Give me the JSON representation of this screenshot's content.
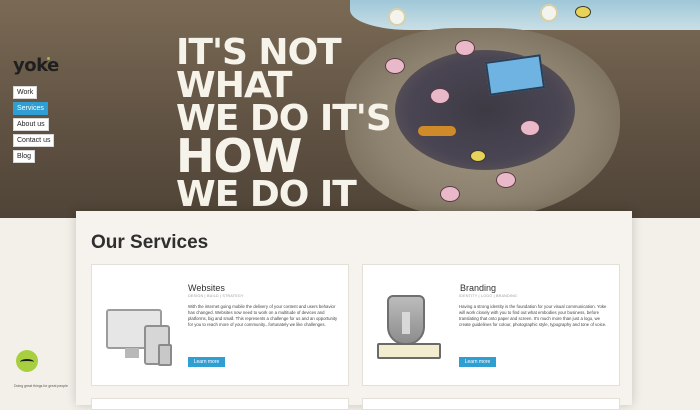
{
  "brand": {
    "logo": "yoke"
  },
  "nav": [
    {
      "label": "Work",
      "active": false
    },
    {
      "label": "Services",
      "active": true
    },
    {
      "label": "About us",
      "active": false
    },
    {
      "label": "Contact us",
      "active": false
    },
    {
      "label": "Blog",
      "active": false
    }
  ],
  "hero": {
    "line1": "IT'S NOT",
    "line2": "WHAT",
    "line3": "WE DO IT'S",
    "line4": "HOW",
    "line5": "WE DO IT"
  },
  "main": {
    "title": "Our Services",
    "services": [
      {
        "name": "Websites",
        "tags": "DESIGN | BUILD | STRATEGY",
        "description": "With the internet going mobile the delivery of your content and users behavior has changed. Websites now need to work on a multitude of devices and platforms, big and small. This represents a challenge for us and an opportunity for you to reach more of your community...fortunately we like challenges.",
        "button": "Learn more"
      },
      {
        "name": "Branding",
        "tags": "IDENTITY | LOGO | BRANDING",
        "description": "Having a strong identity is the foundation for your visual communication. Yoke will work closely with you to find out what embodies your business, before translating that onto paper and screen. It's much more than just a logo, we create guidelines for colour, photographic style, typography and tone of voice.",
        "button": "Learn more"
      }
    ]
  },
  "footer_note": "Doing great things for great people",
  "colors": {
    "accent": "#2f9ed2",
    "brand_green": "#a8cf3f"
  }
}
